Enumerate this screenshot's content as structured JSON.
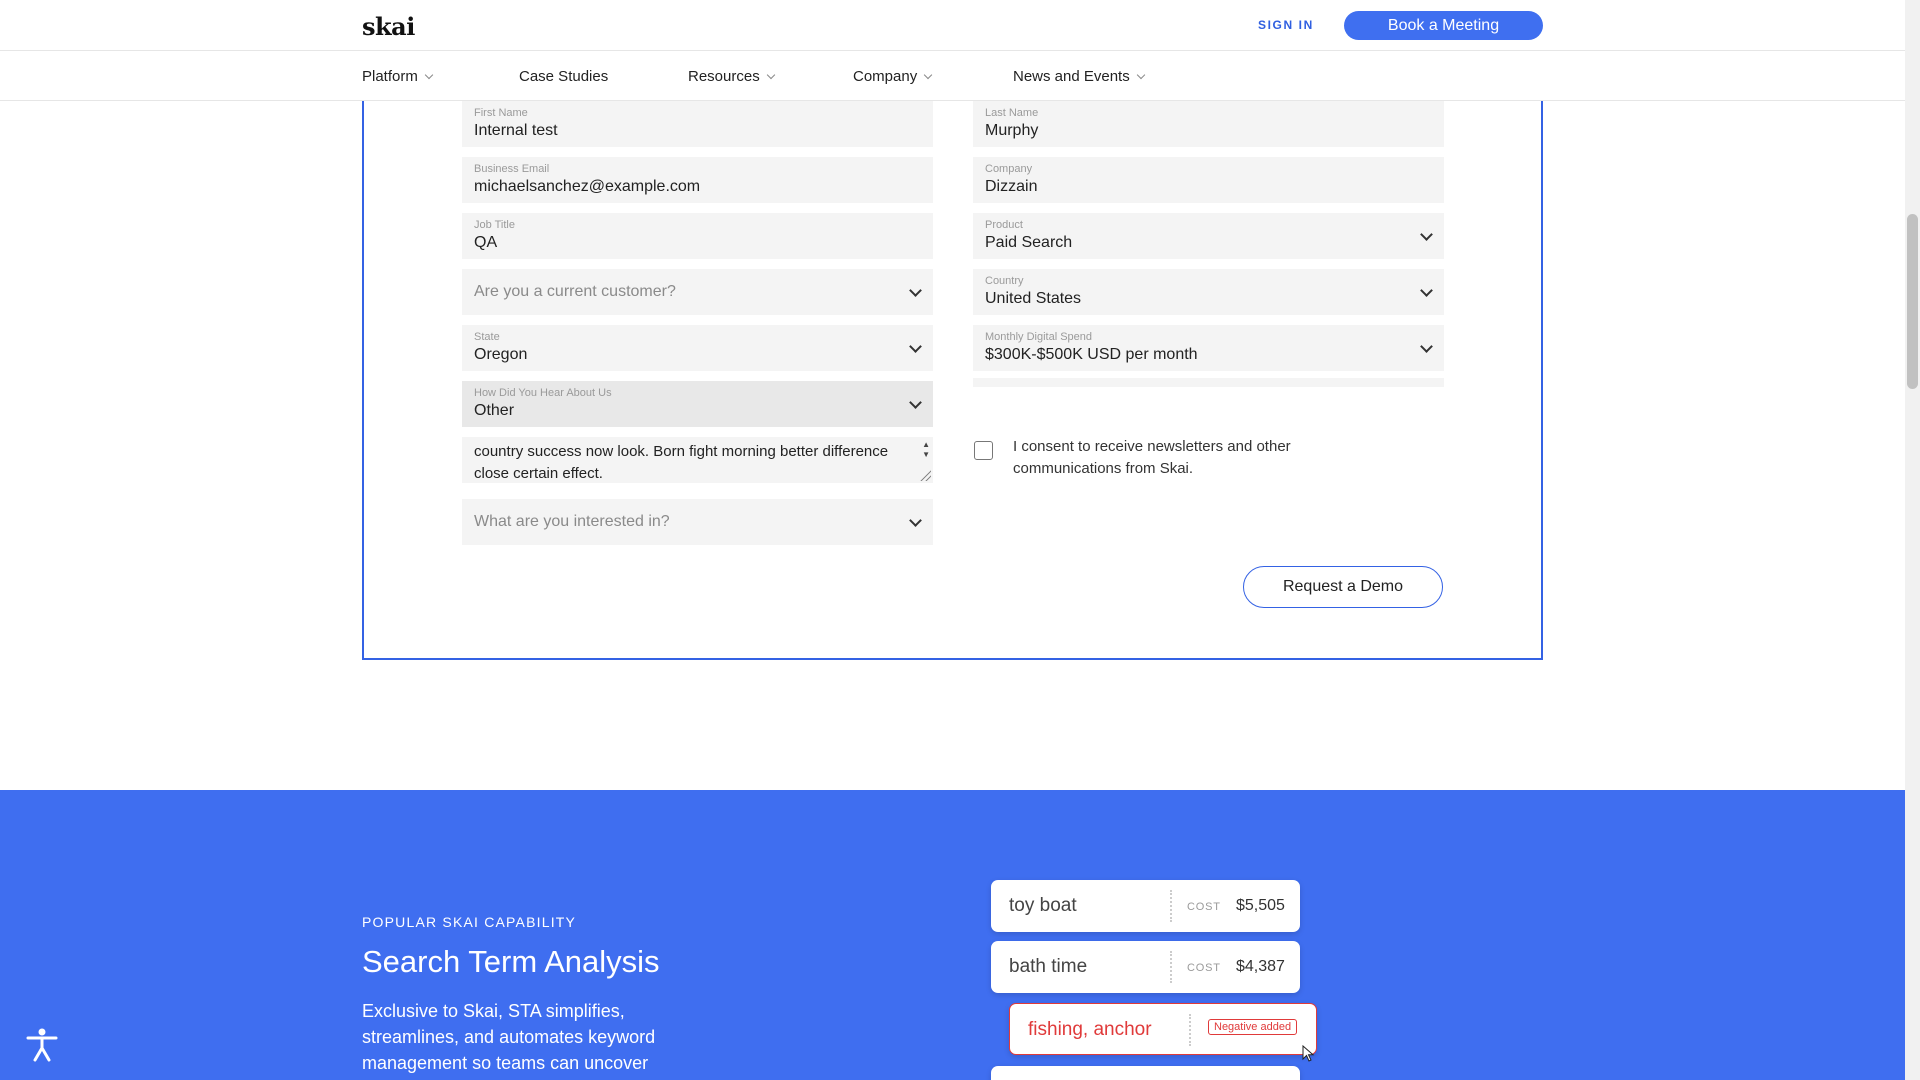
{
  "header": {
    "logo": "skai",
    "sign_in": "SIGN IN",
    "book_meeting": "Book a Meeting"
  },
  "nav": {
    "items": [
      {
        "label": "Platform",
        "has_dropdown": true
      },
      {
        "label": "Case Studies",
        "has_dropdown": false
      },
      {
        "label": "Resources",
        "has_dropdown": true
      },
      {
        "label": "Company",
        "has_dropdown": true
      },
      {
        "label": "News and Events",
        "has_dropdown": true
      }
    ]
  },
  "form": {
    "first_name": {
      "label": "First Name",
      "value": "Internal test"
    },
    "last_name": {
      "label": "Last Name",
      "value": "Murphy"
    },
    "business_email": {
      "label": "Business Email",
      "value": "michaelsanchez@example.com"
    },
    "company": {
      "label": "Company",
      "value": "Dizzain"
    },
    "job_title": {
      "label": "Job Title",
      "value": "QA"
    },
    "product": {
      "label": "Product",
      "value": "Paid Search"
    },
    "current_customer": {
      "placeholder": "Are you a current customer?"
    },
    "country": {
      "label": "Country",
      "value": "United States"
    },
    "state": {
      "label": "State",
      "value": "Oregon"
    },
    "monthly_spend": {
      "label": "Monthly Digital Spend",
      "value": "$300K-$500K USD per month"
    },
    "hear_about": {
      "label": "How Did You Hear About Us",
      "value": "Other"
    },
    "other_text": {
      "value": "country success now look. Born fight morning better difference close certain effect."
    },
    "interested_in": {
      "placeholder": "What are you interested in?"
    },
    "consent": {
      "checked": false,
      "text": "I consent to receive newsletters and other communications from Skai."
    },
    "submit_label": "Request a Demo"
  },
  "capability": {
    "eyebrow": "POPULAR SKAI CAPABILITY",
    "title": "Search Term Analysis",
    "description": "Exclusive to Skai, STA simplifies, streamlines, and automates keyword management so teams can uncover",
    "terms": [
      {
        "term": "toy boat",
        "cost_label": "COST",
        "cost": "$5,505"
      },
      {
        "term": "bath time",
        "cost_label": "COST",
        "cost": "$4,387"
      },
      {
        "term": "fishing, anchor",
        "badge": "Negative added"
      }
    ]
  },
  "colors": {
    "brand_blue": "#3f6ef0",
    "form_border": "#3462e4",
    "negative_red": "#e03a3a"
  }
}
